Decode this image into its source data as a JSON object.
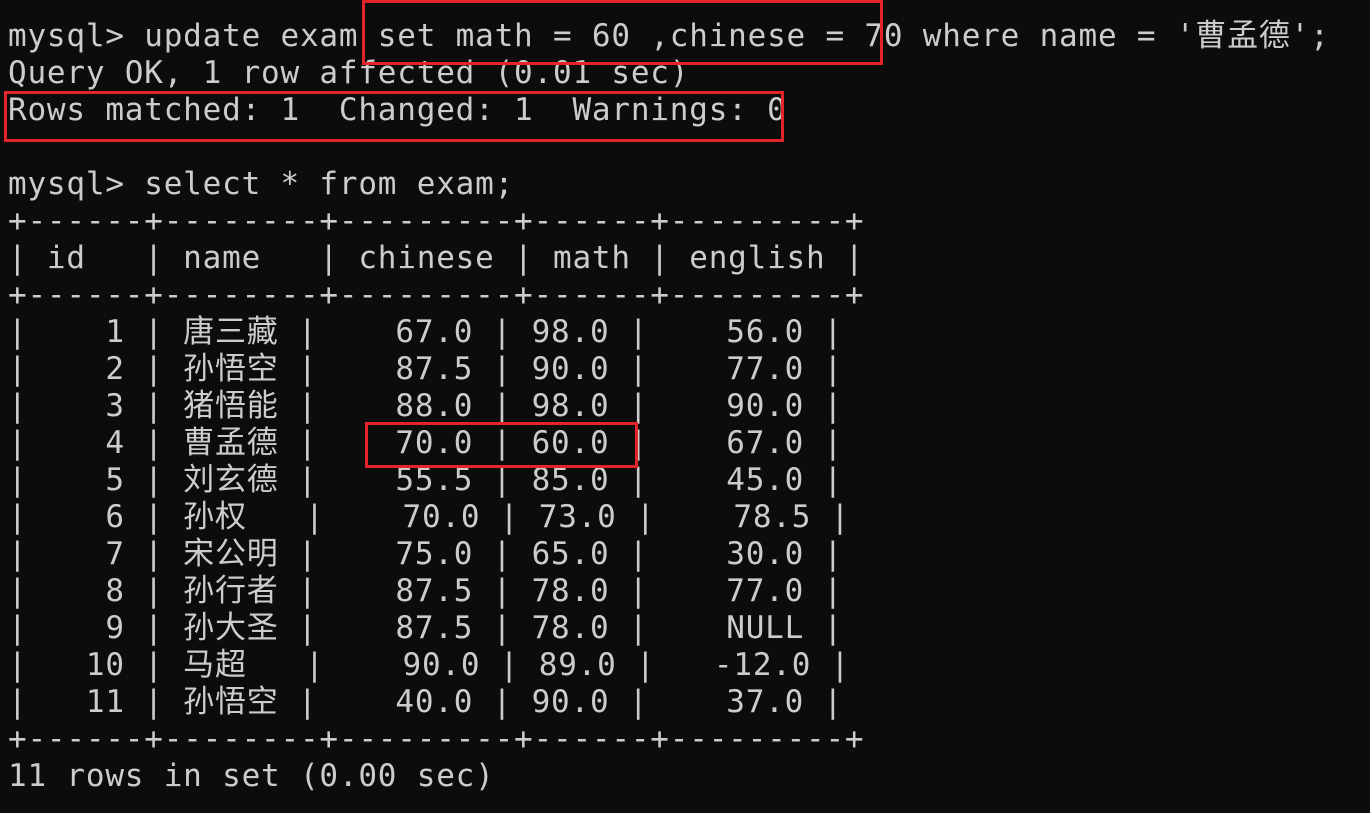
{
  "terminal": {
    "lines": [
      "mysql> update exam set math = 60 ,chinese = 70 where name = '曹孟德';",
      "Query OK, 1 row affected (0.01 sec)",
      "Rows matched: 1  Changed: 1  Warnings: 0",
      "",
      "mysql> select * from exam;",
      "+------+--------+---------+------+---------+",
      "| id   | name   | chinese | math | english |",
      "+------+--------+---------+------+---------+",
      "|    1 | 唐三藏 |    67.0 | 98.0 |    56.0 |",
      "|    2 | 孙悟空 |    87.5 | 90.0 |    77.0 |",
      "|    3 | 猪悟能 |    88.0 | 98.0 |    90.0 |",
      "|    4 | 曹孟德 |    70.0 | 60.0 |    67.0 |",
      "|    5 | 刘玄德 |    55.5 | 85.0 |    45.0 |",
      "|    6 | 孙权   |    70.0 | 73.0 |    78.5 |",
      "|    7 | 宋公明 |    75.0 | 65.0 |    30.0 |",
      "|    8 | 孙行者 |    87.5 | 78.0 |    77.0 |",
      "|    9 | 孙大圣 |    87.5 | 78.0 |    NULL |",
      "|   10 | 马超   |    90.0 | 89.0 |   -12.0 |",
      "|   11 | 孙悟空 |    40.0 | 90.0 |    37.0 |",
      "+------+--------+---------+------+---------+",
      "11 rows in set (0.00 sec)"
    ]
  },
  "highlight_color": "#e3242b"
}
